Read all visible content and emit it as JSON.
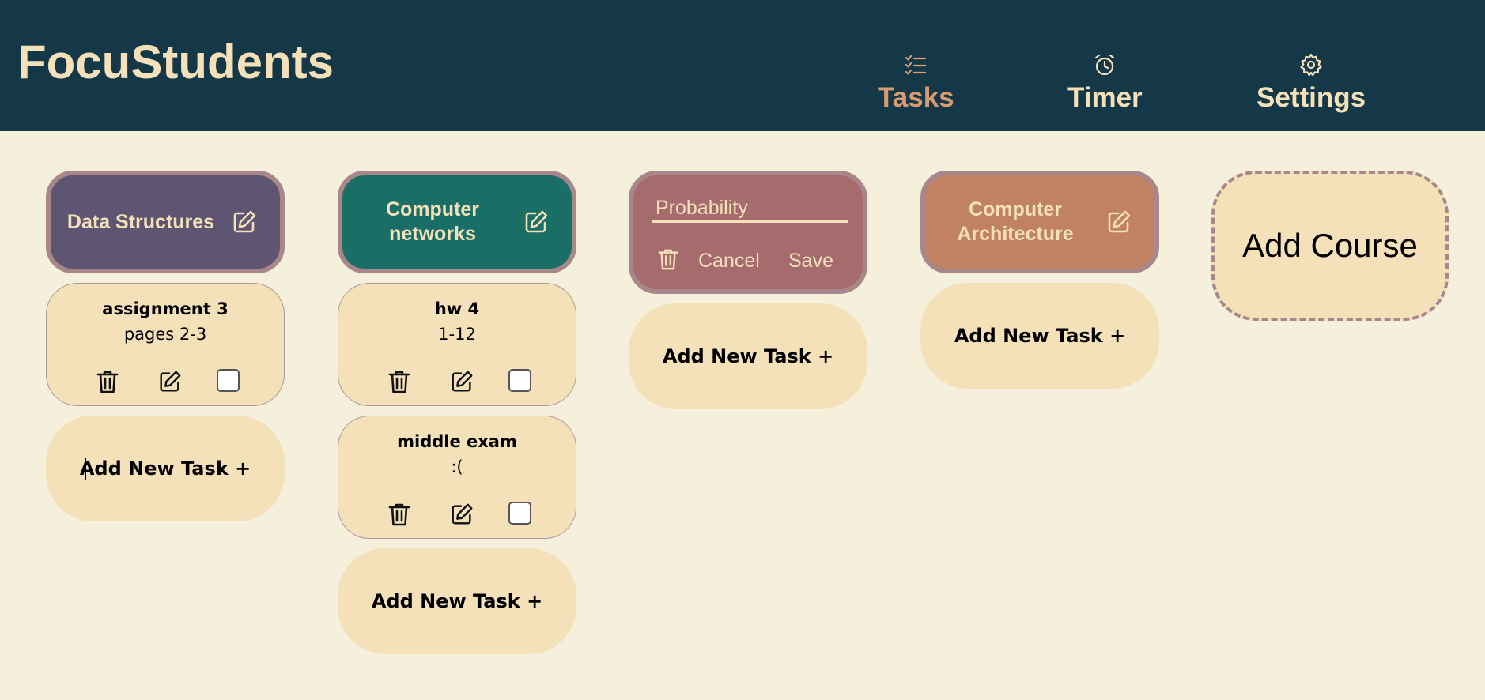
{
  "app": {
    "title": "FocuStudents"
  },
  "nav": [
    {
      "label": "Tasks",
      "icon": "checklist-icon",
      "active": true
    },
    {
      "label": "Timer",
      "icon": "alarm-clock-icon",
      "active": false
    },
    {
      "label": "Settings",
      "icon": "gear-icon",
      "active": false
    }
  ],
  "courses": [
    {
      "name": "Data Structures",
      "color": "#5e5572",
      "tasks": [
        {
          "title": "assignment 3",
          "description": "pages 2-3",
          "done": false
        }
      ],
      "add_task_label": "Add New Task +"
    },
    {
      "name": "Computer networks",
      "color": "#196e65",
      "tasks": [
        {
          "title": "hw 4",
          "description": "1-12",
          "done": false
        },
        {
          "title": "middle exam",
          "description": ":(",
          "done": false
        }
      ],
      "add_task_label": "Add New Task +"
    },
    {
      "editing": true,
      "name_input_value": "",
      "name_placeholder": "Probability",
      "color": "#a66b6d",
      "cancel_label": "Cancel",
      "save_label": "Save",
      "tasks": [],
      "add_task_label": "Add New Task +"
    },
    {
      "name": "Computer Architecture",
      "color": "#c08262",
      "tasks": [],
      "add_task_label": "Add New Task +"
    }
  ],
  "add_course_label": "Add Course",
  "colors": {
    "header_bg": "#143848",
    "page_bg": "#f4f0dc",
    "card_bg": "#f4e0b9",
    "text_light": "#f4e0b9",
    "active_nav": "#d99c71",
    "border": "#a8878a"
  }
}
